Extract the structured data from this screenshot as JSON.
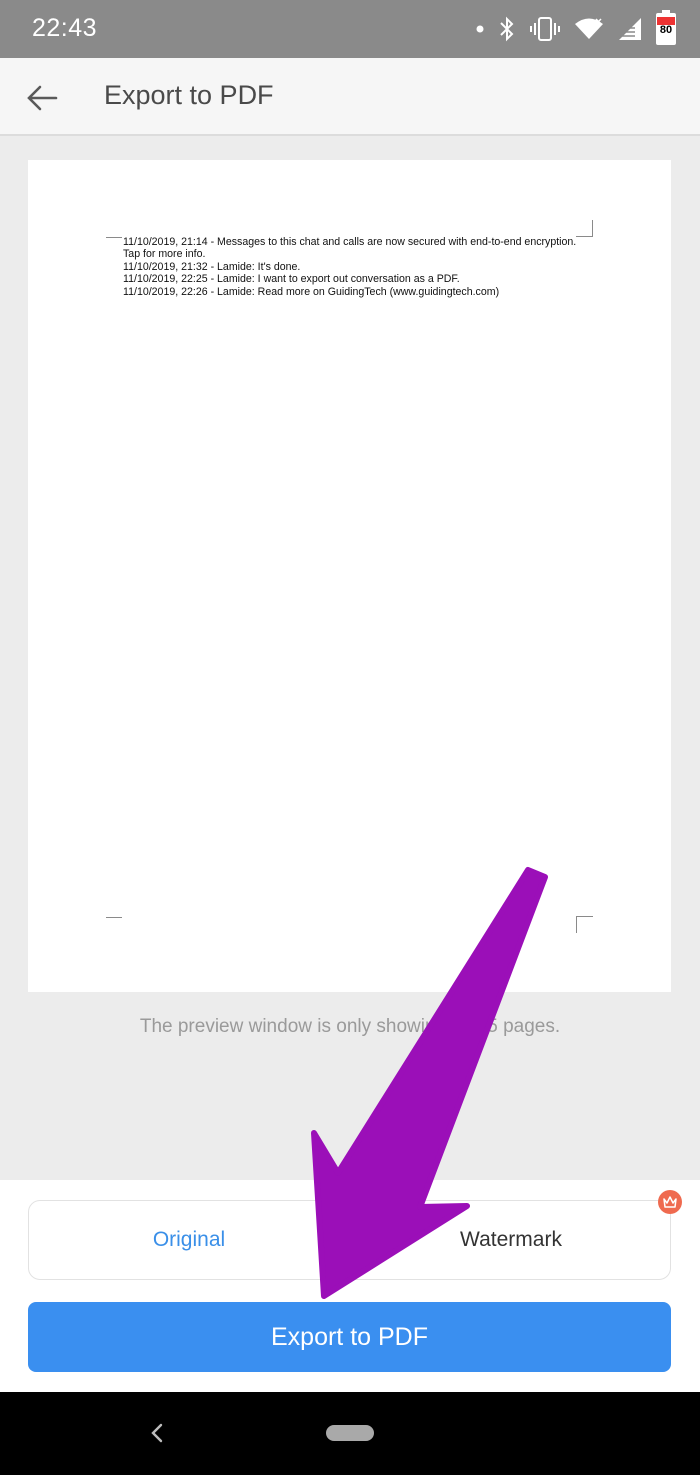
{
  "status_bar": {
    "time": "22:43",
    "battery": "80",
    "icons": [
      "dot-icon",
      "bluetooth-icon",
      "vibrate-icon",
      "wifi-icon",
      "signal-icon",
      "battery-icon"
    ]
  },
  "app_bar": {
    "title": "Export to PDF",
    "back_icon": "arrow-left-icon"
  },
  "preview": {
    "lines": [
      "11/10/2019, 21:14 - Messages to this chat and calls are now secured with end-to-end encryption.",
      "Tap for more info.",
      "11/10/2019, 21:32 - Lamide: It's done.",
      "11/10/2019, 22:25 - Lamide: I want to export out conversation as a PDF.",
      "11/10/2019, 22:26 - Lamide: Read more on GuidingTech (www.guidingtech.com)"
    ],
    "note": "The preview window is only showing first 5 pages."
  },
  "options": {
    "original": "Original",
    "watermark": "Watermark"
  },
  "export_button": "Export to PDF",
  "colors": {
    "accent": "#3a8ff0",
    "selected_option": "#3a8fe8",
    "badge": "#ef6a4f",
    "arrow": "#9b0fb8"
  }
}
